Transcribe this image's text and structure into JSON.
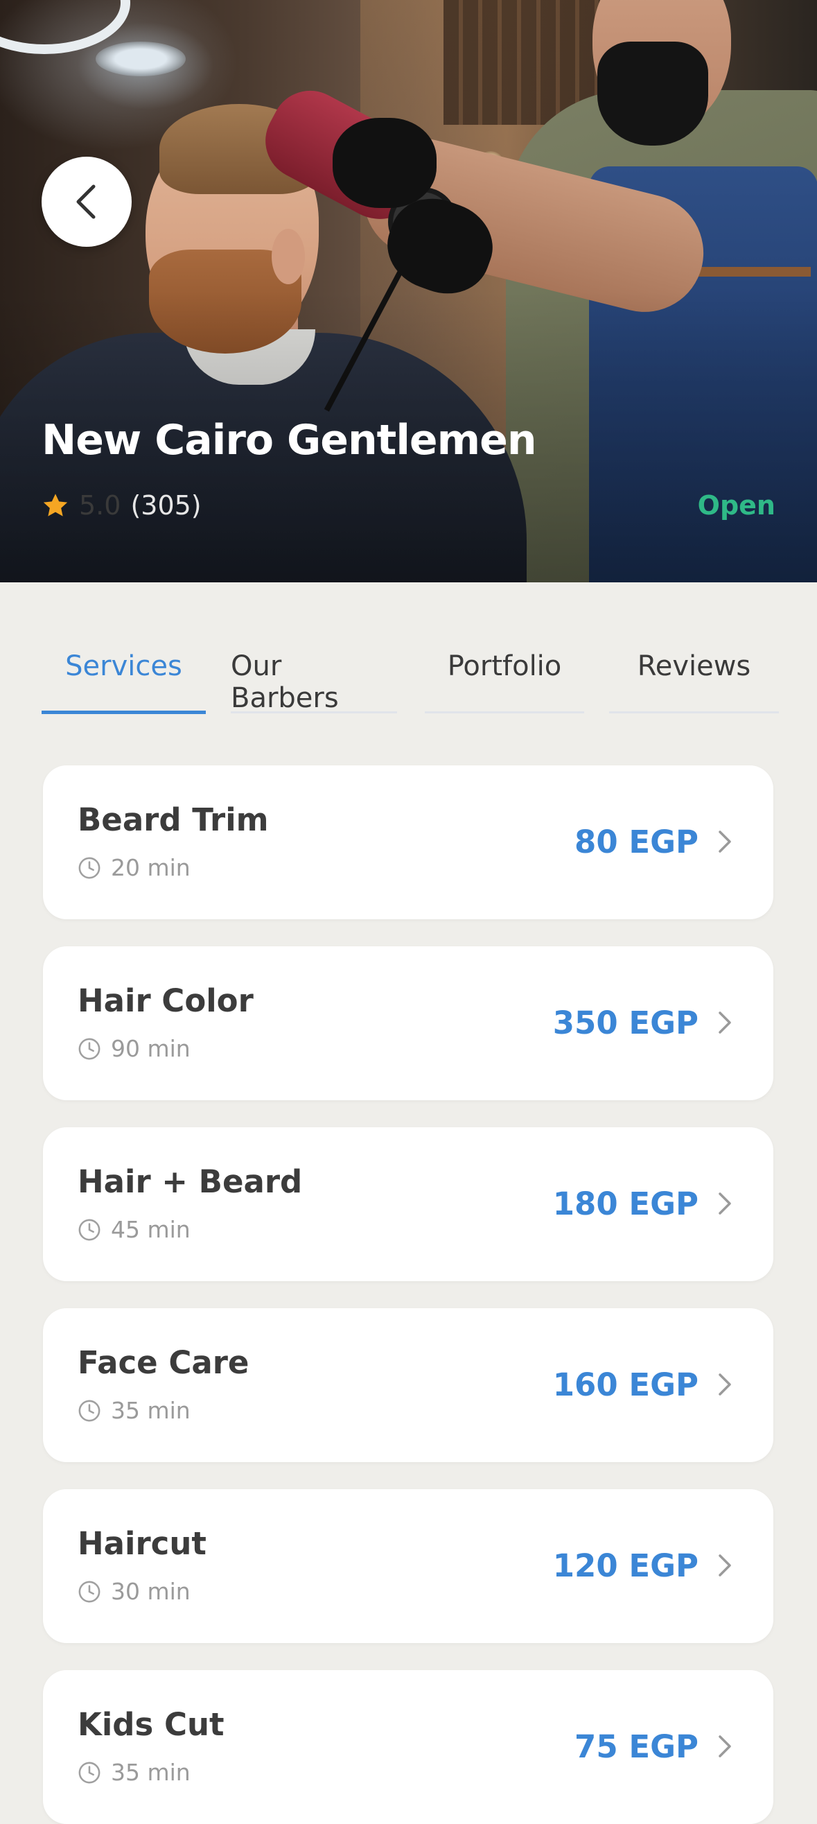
{
  "shop": {
    "name": "New Cairo Gentlemen",
    "rating": "5.0",
    "reviews_count": "(305)",
    "status": "Open"
  },
  "tabs": [
    {
      "label": "Services",
      "active": true
    },
    {
      "label": "Our Barbers",
      "active": false
    },
    {
      "label": "Portfolio",
      "active": false
    },
    {
      "label": "Reviews",
      "active": false
    }
  ],
  "services": [
    {
      "name": "Beard Trim",
      "duration": "20 min",
      "price": "80 EGP"
    },
    {
      "name": "Hair Color",
      "duration": "90 min",
      "price": "350 EGP"
    },
    {
      "name": "Hair + Beard",
      "duration": "45 min",
      "price": "180 EGP"
    },
    {
      "name": "Face Care",
      "duration": "35 min",
      "price": "160 EGP"
    },
    {
      "name": "Haircut",
      "duration": "30 min",
      "price": "120 EGP"
    },
    {
      "name": "Kids Cut",
      "duration": "35 min",
      "price": "75 EGP"
    }
  ],
  "colors": {
    "accent": "#3b86d6",
    "open": "#2fb987",
    "star": "#f5a623",
    "background": "#efeeea"
  },
  "icons": {
    "back": "chevron-left-icon",
    "rating": "star-icon",
    "duration": "clock-icon",
    "service_arrow": "chevron-right-icon"
  }
}
